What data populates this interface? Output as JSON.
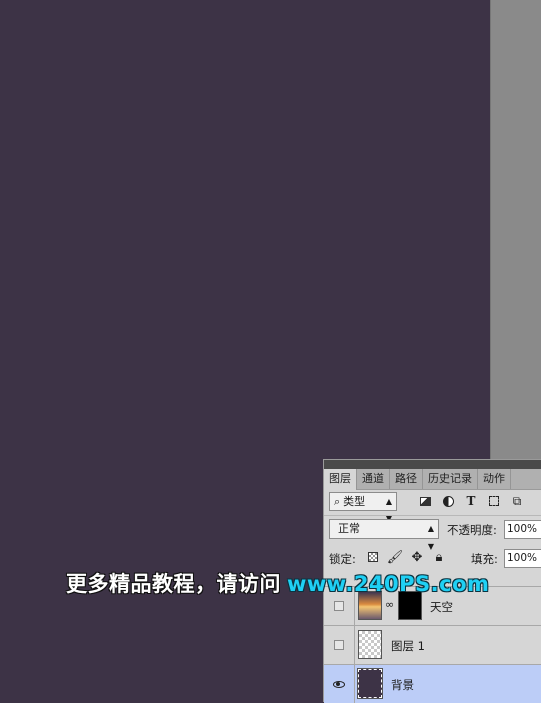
{
  "colors": {
    "canvas": "#3d3346",
    "pasteboard": "#8a8a8a",
    "panel": "#d6d6d6",
    "selected_layer": "#bccdf7",
    "watermark_url": "#1fd0f4"
  },
  "layers_panel": {
    "tabs": [
      "图层",
      "通道",
      "路径",
      "历史记录",
      "动作"
    ],
    "active_tab": "图层",
    "filter": {
      "label": "类型",
      "icon": "search-icon"
    },
    "filter_icons": [
      "image-filter-icon",
      "adjustment-filter-icon",
      "type-filter-icon",
      "shape-filter-icon",
      "smart-object-filter-icon"
    ],
    "blend_mode": "正常",
    "opacity_label": "不透明度:",
    "opacity_value": "100%",
    "lock_label": "锁定:",
    "lock_icons": [
      "lock-transparent-icon",
      "lock-brush-icon",
      "lock-move-icon",
      "lock-all-icon"
    ],
    "fill_label": "填充:",
    "fill_value": "100%",
    "layers": [
      {
        "name": "天空",
        "visible": false,
        "has_mask": true,
        "selected": false
      },
      {
        "name": "图层 1",
        "visible": false,
        "has_mask": false,
        "selected": false
      },
      {
        "name": "背景",
        "visible": true,
        "has_mask": false,
        "selected": true
      }
    ]
  },
  "watermark": {
    "text_cn": "更多精品教程，请访问",
    "url": "www.240PS.com"
  }
}
